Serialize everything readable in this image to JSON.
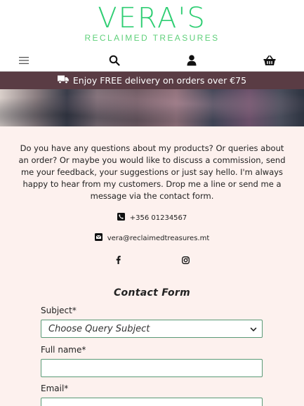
{
  "header": {
    "logo_title": "VERA'S",
    "logo_subtitle": "RECLAIMED TREASURES",
    "nav_icons": [
      "hamburger-menu-icon",
      "search-icon",
      "user-icon",
      "basket-icon"
    ]
  },
  "promo": {
    "text": "Enjoy FREE delivery on orders over €75",
    "icon": "truck-icon"
  },
  "intro": {
    "text": "Do you have any questions about my products? Or queries about an order? Or maybe you would like to discuss a commission, send me your feedback, your suggestions or just say hello. I'm always happy to hear from my customers. Drop me a line or send me a message via the contact form."
  },
  "contact": {
    "phone": "+356 01234567",
    "email": "vera@reclaimedtreasures.mt",
    "social_icons": [
      "facebook-icon",
      "instagram-icon"
    ]
  },
  "form": {
    "title": "Contact Form",
    "subject_label": "Subject*",
    "subject_value": "Choose Query Subject",
    "fullname_label": "Full name*",
    "email_label": "Email*"
  },
  "colors": {
    "brand_green": "#2fce73",
    "promo_bg": "#5a3c44",
    "page_bg": "#fdf1ee",
    "field_border": "#5a9a76"
  }
}
